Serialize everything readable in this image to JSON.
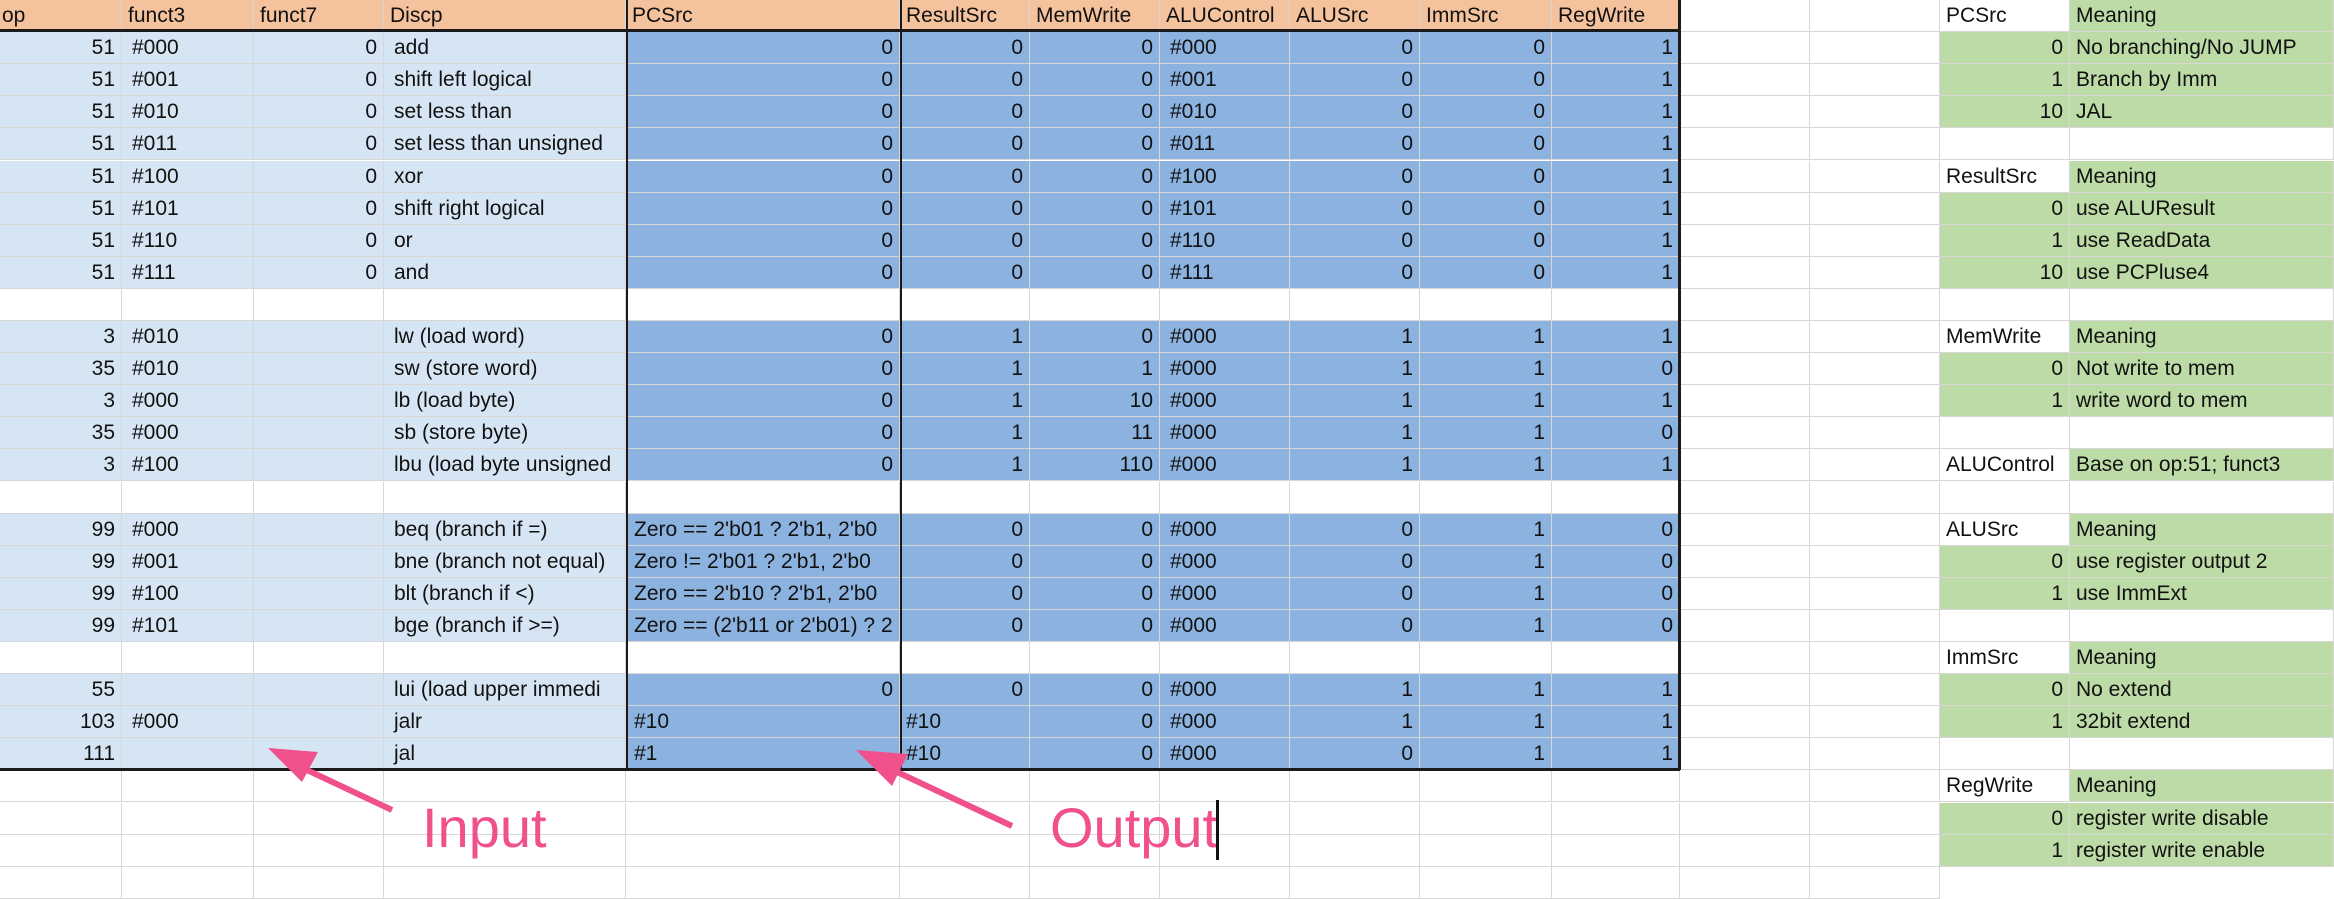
{
  "colors": {
    "header": "#f4c39d",
    "input": "#d6e5f3",
    "output": "#8cb3e0",
    "legend": "#bcdba6",
    "annotation": "#f0508b"
  },
  "headers": [
    "op",
    "funct3",
    "funct7",
    "Discp",
    "PCSrc",
    "ResultSrc",
    "MemWrite",
    "ALUControl",
    "ALUSrc",
    "ImmSrc",
    "RegWrite"
  ],
  "rows": [
    {
      "op": "51",
      "funct3": "#000",
      "funct7": "0",
      "discp": "add",
      "pcsrc": "0",
      "resultsrc": "0",
      "memwrite": "0",
      "alucontrol": "#000",
      "alusrc": "0",
      "immsrc": "0",
      "regwrite": "1"
    },
    {
      "op": "51",
      "funct3": "#001",
      "funct7": "0",
      "discp": "shift left logical",
      "pcsrc": "0",
      "resultsrc": "0",
      "memwrite": "0",
      "alucontrol": "#001",
      "alusrc": "0",
      "immsrc": "0",
      "regwrite": "1"
    },
    {
      "op": "51",
      "funct3": "#010",
      "funct7": "0",
      "discp": "set less than",
      "pcsrc": "0",
      "resultsrc": "0",
      "memwrite": "0",
      "alucontrol": "#010",
      "alusrc": "0",
      "immsrc": "0",
      "regwrite": "1"
    },
    {
      "op": "51",
      "funct3": "#011",
      "funct7": "0",
      "discp": "set less than unsigned",
      "pcsrc": "0",
      "resultsrc": "0",
      "memwrite": "0",
      "alucontrol": "#011",
      "alusrc": "0",
      "immsrc": "0",
      "regwrite": "1"
    },
    {
      "op": "51",
      "funct3": "#100",
      "funct7": "0",
      "discp": "xor",
      "pcsrc": "0",
      "resultsrc": "0",
      "memwrite": "0",
      "alucontrol": "#100",
      "alusrc": "0",
      "immsrc": "0",
      "regwrite": "1"
    },
    {
      "op": "51",
      "funct3": "#101",
      "funct7": "0",
      "discp": "shift right logical",
      "pcsrc": "0",
      "resultsrc": "0",
      "memwrite": "0",
      "alucontrol": "#101",
      "alusrc": "0",
      "immsrc": "0",
      "regwrite": "1"
    },
    {
      "op": "51",
      "funct3": "#110",
      "funct7": "0",
      "discp": "or",
      "pcsrc": "0",
      "resultsrc": "0",
      "memwrite": "0",
      "alucontrol": "#110",
      "alusrc": "0",
      "immsrc": "0",
      "regwrite": "1"
    },
    {
      "op": "51",
      "funct3": "#111",
      "funct7": "0",
      "discp": "and",
      "pcsrc": "0",
      "resultsrc": "0",
      "memwrite": "0",
      "alucontrol": "#111",
      "alusrc": "0",
      "immsrc": "0",
      "regwrite": "1"
    },
    null,
    {
      "op": "3",
      "funct3": "#010",
      "funct7": "",
      "discp": "lw (load word)",
      "pcsrc": "0",
      "resultsrc": "1",
      "memwrite": "0",
      "alucontrol": "#000",
      "alusrc": "1",
      "immsrc": "1",
      "regwrite": "1"
    },
    {
      "op": "35",
      "funct3": "#010",
      "funct7": "",
      "discp": "sw (store word)",
      "pcsrc": "0",
      "resultsrc": "1",
      "memwrite": "1",
      "alucontrol": "#000",
      "alusrc": "1",
      "immsrc": "1",
      "regwrite": "0"
    },
    {
      "op": "3",
      "funct3": "#000",
      "funct7": "",
      "discp": "lb (load byte)",
      "pcsrc": "0",
      "resultsrc": "1",
      "memwrite": "10",
      "alucontrol": "#000",
      "alusrc": "1",
      "immsrc": "1",
      "regwrite": "1"
    },
    {
      "op": "35",
      "funct3": "#000",
      "funct7": "",
      "discp": "sb (store byte)",
      "pcsrc": "0",
      "resultsrc": "1",
      "memwrite": "11",
      "alucontrol": "#000",
      "alusrc": "1",
      "immsrc": "1",
      "regwrite": "0"
    },
    {
      "op": "3",
      "funct3": "#100",
      "funct7": "",
      "discp": "lbu (load byte unsigned",
      "pcsrc": "0",
      "resultsrc": "1",
      "memwrite": "110",
      "alucontrol": "#000",
      "alusrc": "1",
      "immsrc": "1",
      "regwrite": "1"
    },
    null,
    {
      "op": "99",
      "funct3": "#000",
      "funct7": "",
      "discp": "beq (branch if =)",
      "pcsrc": "Zero == 2'b01 ? 2'b1, 2'b0",
      "resultsrc": "0",
      "memwrite": "0",
      "alucontrol": "#000",
      "alusrc": "0",
      "immsrc": "1",
      "regwrite": "0"
    },
    {
      "op": "99",
      "funct3": "#001",
      "funct7": "",
      "discp": "bne (branch not equal)",
      "pcsrc": "Zero  != 2'b01 ? 2'b1, 2'b0",
      "resultsrc": "0",
      "memwrite": "0",
      "alucontrol": "#000",
      "alusrc": "0",
      "immsrc": "1",
      "regwrite": "0"
    },
    {
      "op": "99",
      "funct3": "#100",
      "funct7": "",
      "discp": "blt (branch if <)",
      "pcsrc": "Zero == 2'b10 ? 2'b1, 2'b0",
      "resultsrc": "0",
      "memwrite": "0",
      "alucontrol": "#000",
      "alusrc": "0",
      "immsrc": "1",
      "regwrite": "0"
    },
    {
      "op": "99",
      "funct3": "#101",
      "funct7": "",
      "discp": "bge (branch if >=)",
      "pcsrc": "Zero == (2'b11 or 2'b01) ? 2",
      "resultsrc": "0",
      "memwrite": "0",
      "alucontrol": "#000",
      "alusrc": "0",
      "immsrc": "1",
      "regwrite": "0"
    },
    null,
    {
      "op": "55",
      "funct3": "",
      "funct7": "",
      "discp": "lui (load upper immedi",
      "pcsrc": "0",
      "resultsrc": "0",
      "memwrite": "0",
      "alucontrol": "#000",
      "alusrc": "1",
      "immsrc": "1",
      "regwrite": "1"
    },
    {
      "op": "103",
      "funct3": "#000",
      "funct7": "",
      "discp": "jalr",
      "pcsrc": "#10",
      "resultsrc": "#10",
      "memwrite": "0",
      "alucontrol": "#000",
      "alusrc": "1",
      "immsrc": "1",
      "regwrite": "1"
    },
    {
      "op": "111",
      "funct3": "",
      "funct7": "",
      "discp": "jal",
      "pcsrc": "#1",
      "resultsrc": "#10",
      "memwrite": "0",
      "alucontrol": "#000",
      "alusrc": "0",
      "immsrc": "1",
      "regwrite": "1"
    }
  ],
  "legend": [
    {
      "type": "header",
      "key": "PCSrc",
      "value": "Meaning"
    },
    {
      "type": "item",
      "key": "0",
      "value": "No branching/No JUMP"
    },
    {
      "type": "item",
      "key": "1",
      "value": "Branch by Imm"
    },
    {
      "type": "item",
      "key": "10",
      "value": "JAL"
    },
    {
      "type": "blank"
    },
    {
      "type": "header",
      "key": "ResultSrc",
      "value": "Meaning"
    },
    {
      "type": "item",
      "key": "0",
      "value": "use ALUResult"
    },
    {
      "type": "item",
      "key": "1",
      "value": "use ReadData"
    },
    {
      "type": "item",
      "key": "10",
      "value": "use PCPluse4"
    },
    {
      "type": "blank"
    },
    {
      "type": "header",
      "key": "MemWrite",
      "value": "Meaning"
    },
    {
      "type": "item",
      "key": "0",
      "value": "Not write to mem"
    },
    {
      "type": "item",
      "key": "1",
      "value": "write word to mem"
    },
    {
      "type": "blank"
    },
    {
      "type": "header",
      "key": "ALUControl",
      "value": "Base on op:51; funct3"
    },
    {
      "type": "blank"
    },
    {
      "type": "header",
      "key": "ALUSrc",
      "value": "Meaning"
    },
    {
      "type": "item",
      "key": "0",
      "value": "use register output 2"
    },
    {
      "type": "item",
      "key": "1",
      "value": "use ImmExt"
    },
    {
      "type": "blank"
    },
    {
      "type": "header",
      "key": "ImmSrc",
      "value": "Meaning"
    },
    {
      "type": "item",
      "key": "0",
      "value": "No extend"
    },
    {
      "type": "item",
      "key": "1",
      "value": "32bit extend"
    },
    {
      "type": "blank"
    },
    {
      "type": "header",
      "key": "RegWrite",
      "value": "Meaning"
    },
    {
      "type": "item",
      "key": "0",
      "value": "register write disable"
    },
    {
      "type": "item",
      "key": "1",
      "value": "register write enable"
    }
  ],
  "annotations": {
    "input": "Input",
    "output": "Output"
  }
}
